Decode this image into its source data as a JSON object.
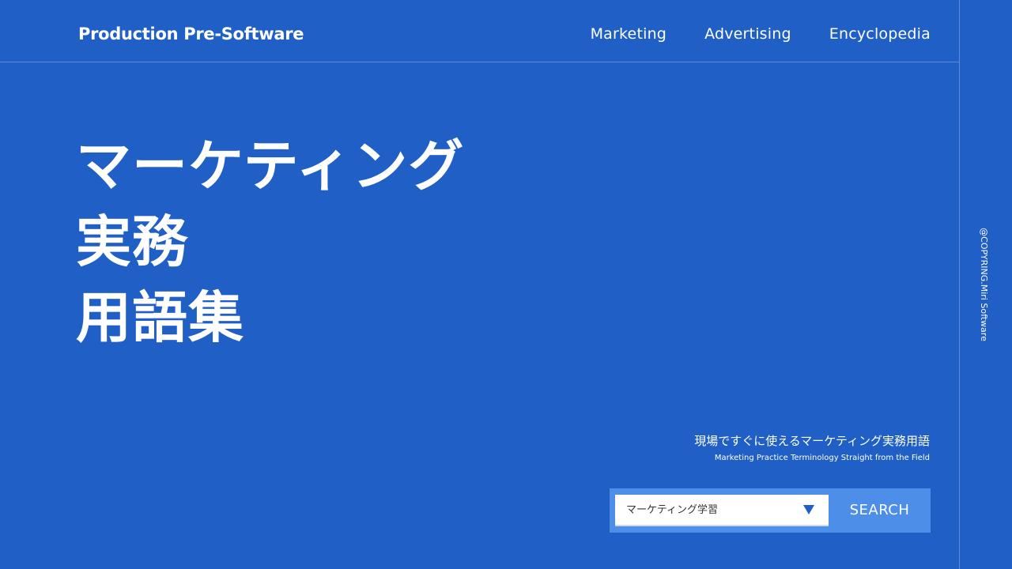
{
  "header": {
    "brand": "Production Pre-Software",
    "nav": [
      "Marketing",
      "Advertising",
      "Encyclopedia"
    ]
  },
  "hero": {
    "lines": [
      "マーケティング",
      "実務",
      "用語集"
    ]
  },
  "side_text": "@COPYRING.Miri Software",
  "tagline": {
    "ja": "現場ですぐに使えるマーケティング実務用語",
    "en": "Marketing Practice Terminology Straight from the Field"
  },
  "search": {
    "selected": "マーケティング学習",
    "button": "SEARCH"
  },
  "colors": {
    "background": "#1f5fc6",
    "search_bar": "#4d8ee8"
  }
}
